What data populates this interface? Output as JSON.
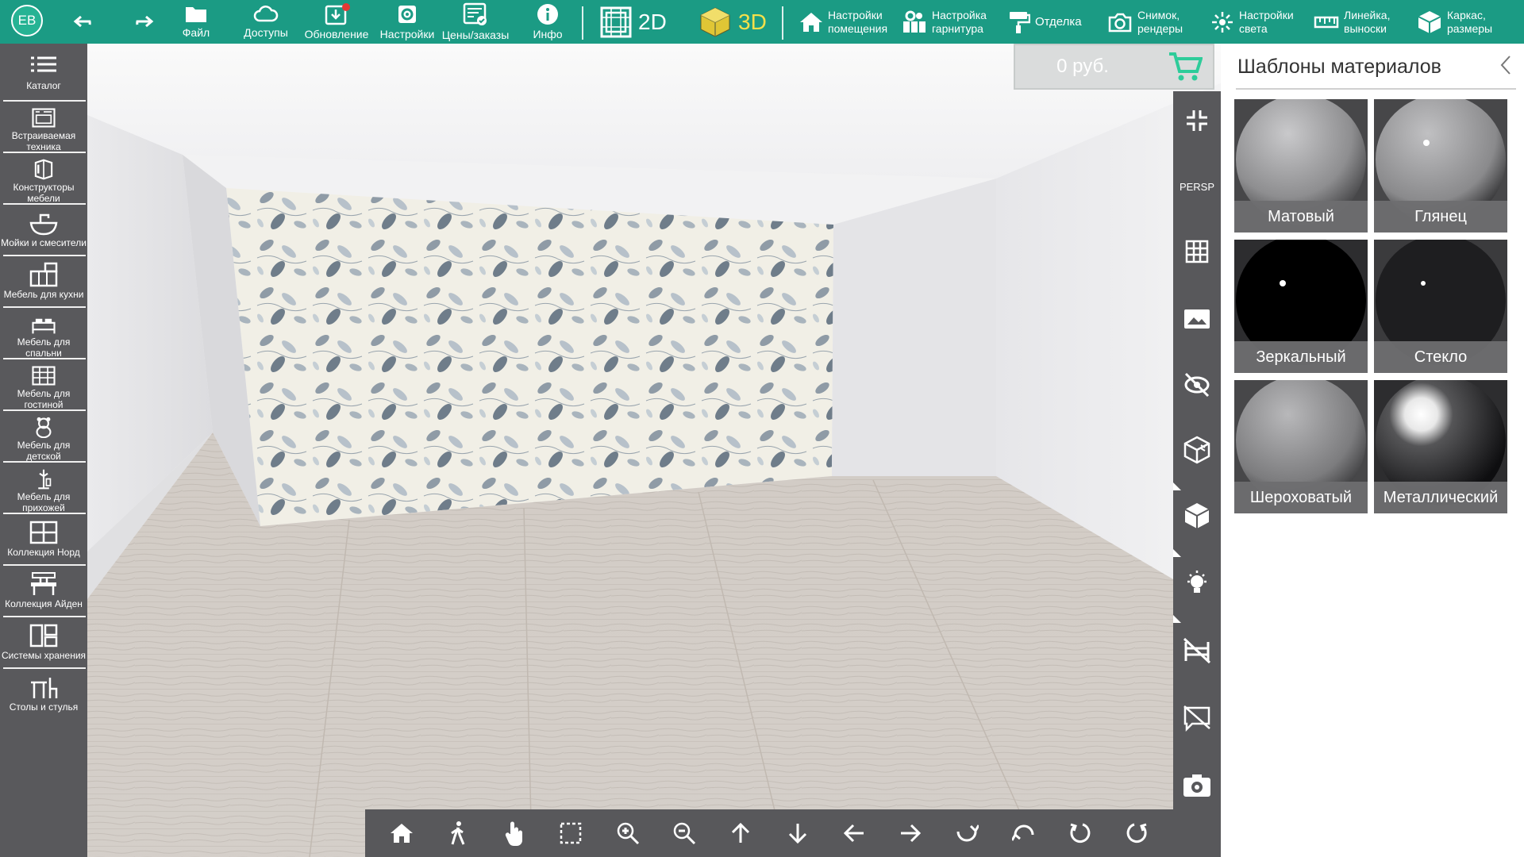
{
  "user": {
    "initials": "EB"
  },
  "toolbar": {
    "file": "Файл",
    "access": "Доступы",
    "update": "Обновление",
    "settings": "Настройки",
    "prices": "Цены/заказы",
    "info": "Инфо",
    "mode_2d": "2D",
    "mode_3d": "3D",
    "room_settings": [
      "Настройки",
      "помещения"
    ],
    "set_settings": [
      "Настройка",
      "гарнитура"
    ],
    "finish": "Отделка",
    "snapshot": [
      "Снимок,",
      "рендеры"
    ],
    "light_settings": [
      "Настройки",
      "света"
    ],
    "ruler": [
      "Линейка,",
      "выноски"
    ],
    "frame": [
      "Каркас,",
      "размеры"
    ]
  },
  "sidebar": {
    "items": [
      {
        "label": "Каталог",
        "icon": "list-icon"
      },
      {
        "label": "Встраиваемая техника",
        "icon": "oven-icon"
      },
      {
        "label": "Конструкторы мебели",
        "icon": "cube-builder-icon"
      },
      {
        "label": "Мойки и смесители",
        "icon": "sink-icon"
      },
      {
        "label": "Мебель для кухни",
        "icon": "kitchen-icon"
      },
      {
        "label": "Мебель для спальни",
        "icon": "bed-icon"
      },
      {
        "label": "Мебель для гостиной",
        "icon": "wardrobe-icon"
      },
      {
        "label": "Мебель для детской",
        "icon": "teddy-bear-icon"
      },
      {
        "label": "Мебель для прихожей",
        "icon": "coat-rack-icon"
      },
      {
        "label": "Коллекция Норд",
        "icon": "shelf-icon"
      },
      {
        "label": "Коллекция Айден",
        "icon": "desk-icon"
      },
      {
        "label": "Системы хранения",
        "icon": "storage-icon"
      },
      {
        "label": "Столы и стулья",
        "icon": "table-chair-icon"
      }
    ]
  },
  "price": {
    "value": "0 руб."
  },
  "view": {
    "projection": "PERSP"
  },
  "panel": {
    "title": "Шаблоны материалов",
    "materials": [
      {
        "label": "Матовый",
        "type": "matte"
      },
      {
        "label": "Глянец",
        "type": "gloss"
      },
      {
        "label": "Зеркальный",
        "type": "mirror"
      },
      {
        "label": "Стекло",
        "type": "glass"
      },
      {
        "label": "Шероховатый",
        "type": "rough"
      },
      {
        "label": "Металлический",
        "type": "metal"
      }
    ]
  },
  "colors": {
    "accent": "#1b9b84",
    "sidebar": "#59595c",
    "toolbar_text": "#ffffff",
    "mode_3d": "#f5e04a"
  }
}
